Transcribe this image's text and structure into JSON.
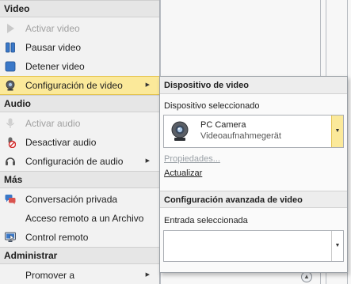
{
  "menu": {
    "sections": {
      "video": "Video",
      "audio": "Audio",
      "more": "Más",
      "admin": "Administrar"
    },
    "items": {
      "activar_video": "Activar video",
      "pausar_video": "Pausar video",
      "detener_video": "Detener video",
      "config_video": "Configuración de video",
      "activar_audio": "Activar audio",
      "desactivar_audio": "Desactivar audio",
      "config_audio": "Configuración de audio",
      "conversacion": "Conversación privada",
      "acceso_remoto": "Acceso remoto a un Archivo",
      "control_remoto": "Control remoto",
      "promover": "Promover a"
    }
  },
  "popup": {
    "header_device": "Dispositivo de video",
    "selected_device_label": "Dispositivo seleccionado",
    "device": {
      "name": "PC Camera",
      "type": "Videoaufnahmegerät"
    },
    "properties_link": "Propiedades...",
    "update_link": "Actualizar",
    "header_advanced": "Configuración avanzada de video",
    "selected_input_label": "Entrada seleccionada",
    "selected_input_value": ""
  },
  "colors": {
    "highlight": "#fbe99a",
    "highlight_border": "#e4c34f",
    "icon_blue": "#3a78c8"
  }
}
